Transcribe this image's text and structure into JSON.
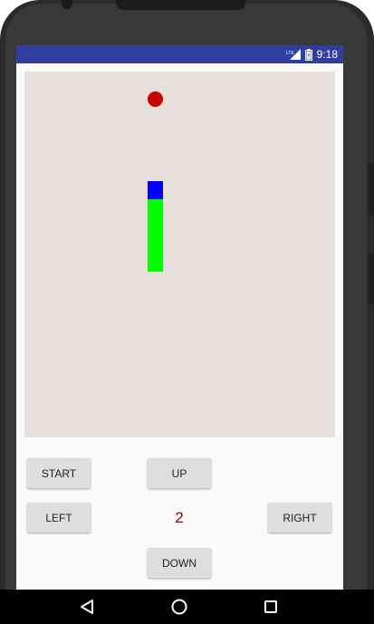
{
  "status_bar": {
    "network": "LTE",
    "time": "9:18",
    "color": "#303f9f"
  },
  "game": {
    "board_color": "#e6dfdc",
    "food_color": "#cc0000",
    "snake_head_color": "#0000ff",
    "snake_body_color": "#00ff00"
  },
  "controls": {
    "start_label": "START",
    "up_label": "UP",
    "left_label": "LEFT",
    "right_label": "RIGHT",
    "down_label": "DOWN"
  },
  "score": "2",
  "nav_bar": {
    "back_icon": "back-triangle-icon",
    "home_icon": "home-circle-icon",
    "recent_icon": "recent-square-icon"
  }
}
